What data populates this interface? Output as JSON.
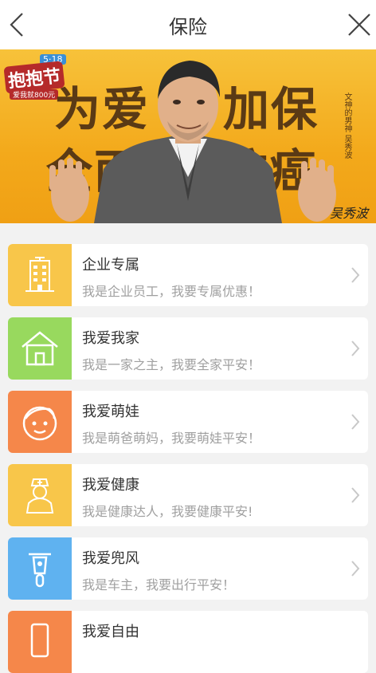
{
  "header": {
    "title": "保险"
  },
  "banner": {
    "festival_tag": "5·18",
    "festival_name": "抱抱节",
    "festival_sub": "爱我就800元",
    "headline_1": "为爱",
    "headline_2": "加保",
    "headline_3": "全面",
    "headline_4": "防癌",
    "side_text": "文神的男神 吴秀波",
    "signature": "吴秀波"
  },
  "items": [
    {
      "title": "企业专属",
      "subtitle": "我是企业员工，我要专属优惠！",
      "icon": "building-icon",
      "color": "#f8c64a"
    },
    {
      "title": "我爱我家",
      "subtitle": "我是一家之主，我要全家平安！",
      "icon": "house-icon",
      "color": "#98d95e"
    },
    {
      "title": "我爱萌娃",
      "subtitle": "我是萌爸萌妈，我要萌娃平安！",
      "icon": "baby-face-icon",
      "color": "#f5874a"
    },
    {
      "title": "我爱健康",
      "subtitle": "我是健康达人，我要健康平安!",
      "icon": "nurse-icon",
      "color": "#f8c64a"
    },
    {
      "title": "我爱兜风",
      "subtitle": "我是车主，我要出行平安！",
      "icon": "scooter-icon",
      "color": "#5fb2f0"
    },
    {
      "title": "我爱自由",
      "subtitle": "",
      "icon": "phone-icon",
      "color": "#f5874a"
    }
  ]
}
